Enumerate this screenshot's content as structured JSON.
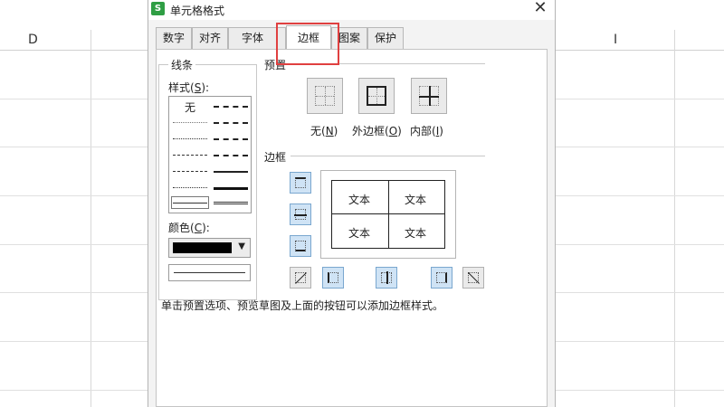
{
  "sheet": {
    "columns": [
      "D",
      "I"
    ]
  },
  "dialog": {
    "app_icon_letter": "S",
    "title": "单元格格式",
    "close_glyph": "✕",
    "tabs": [
      {
        "label": "数字"
      },
      {
        "label": "对齐"
      },
      {
        "label": "字体"
      },
      {
        "label": "边框"
      },
      {
        "label": "图案"
      },
      {
        "label": "保护"
      }
    ],
    "active_tab": "边框",
    "line": {
      "group_title": "线条",
      "style_label": "样式(",
      "style_key": "S",
      "style_label_end": "):",
      "none_option": "无",
      "color_label": "颜色(",
      "color_key": "C",
      "color_label_end": "):",
      "color_value": "#000000"
    },
    "presets": {
      "title": "预置",
      "items": [
        {
          "label": "无(",
          "key": "N",
          "end": ")"
        },
        {
          "label": "外边框(",
          "key": "O",
          "end": ")"
        },
        {
          "label": "内部(",
          "key": "I",
          "end": ")"
        }
      ]
    },
    "border": {
      "title": "边框",
      "preview_cells": [
        "文本",
        "文本",
        "文本",
        "文本"
      ]
    },
    "hint": "单击预置选项、预览草图及上面的按钮可以添加边框样式。"
  },
  "colors": {
    "highlight": "#e04040",
    "button_active": "#cfe3f5"
  }
}
